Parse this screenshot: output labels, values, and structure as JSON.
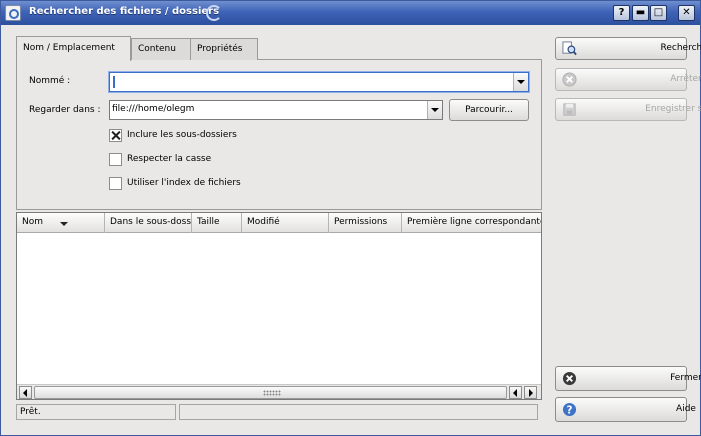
{
  "window": {
    "title": "Rechercher des fichiers / dossiers",
    "controls": {
      "help": "?",
      "minimize": "▬",
      "maximize": "□",
      "close": "✕"
    }
  },
  "tabs": [
    {
      "label": "Nom / Emplacement",
      "active": true
    },
    {
      "label": "Contenu",
      "active": false
    },
    {
      "label": "Propriétés",
      "active": false
    }
  ],
  "form": {
    "named_label": "Nommé :",
    "named_value": "",
    "look_in_label": "Regarder dans :",
    "look_in_value": "file:///home/olegm",
    "browse_button": "Parcourir...",
    "include_subfolders": {
      "label": "Inclure les sous-dossiers",
      "checked": true
    },
    "case_sensitive": {
      "label": "Respecter la casse",
      "checked": false
    },
    "use_index": {
      "label": "Utiliser l'index de fichiers",
      "checked": false
    }
  },
  "results": {
    "columns": [
      "Nom",
      "Dans le sous-dossier",
      "Taille",
      "Modifié",
      "Permissions",
      "Première ligne correspondante"
    ],
    "rows": []
  },
  "side_buttons": {
    "search": "Rechercher",
    "stop": "Arrêter",
    "save_as": "Enregistrer sous...",
    "close": "Fermer",
    "help": "Aide"
  },
  "status": {
    "text": "Prêt.",
    "secondary": ""
  },
  "colors": {
    "titlebar": "#3f63b6",
    "accent": "#3b6fc7",
    "window_bg": "#e9e8e6"
  }
}
